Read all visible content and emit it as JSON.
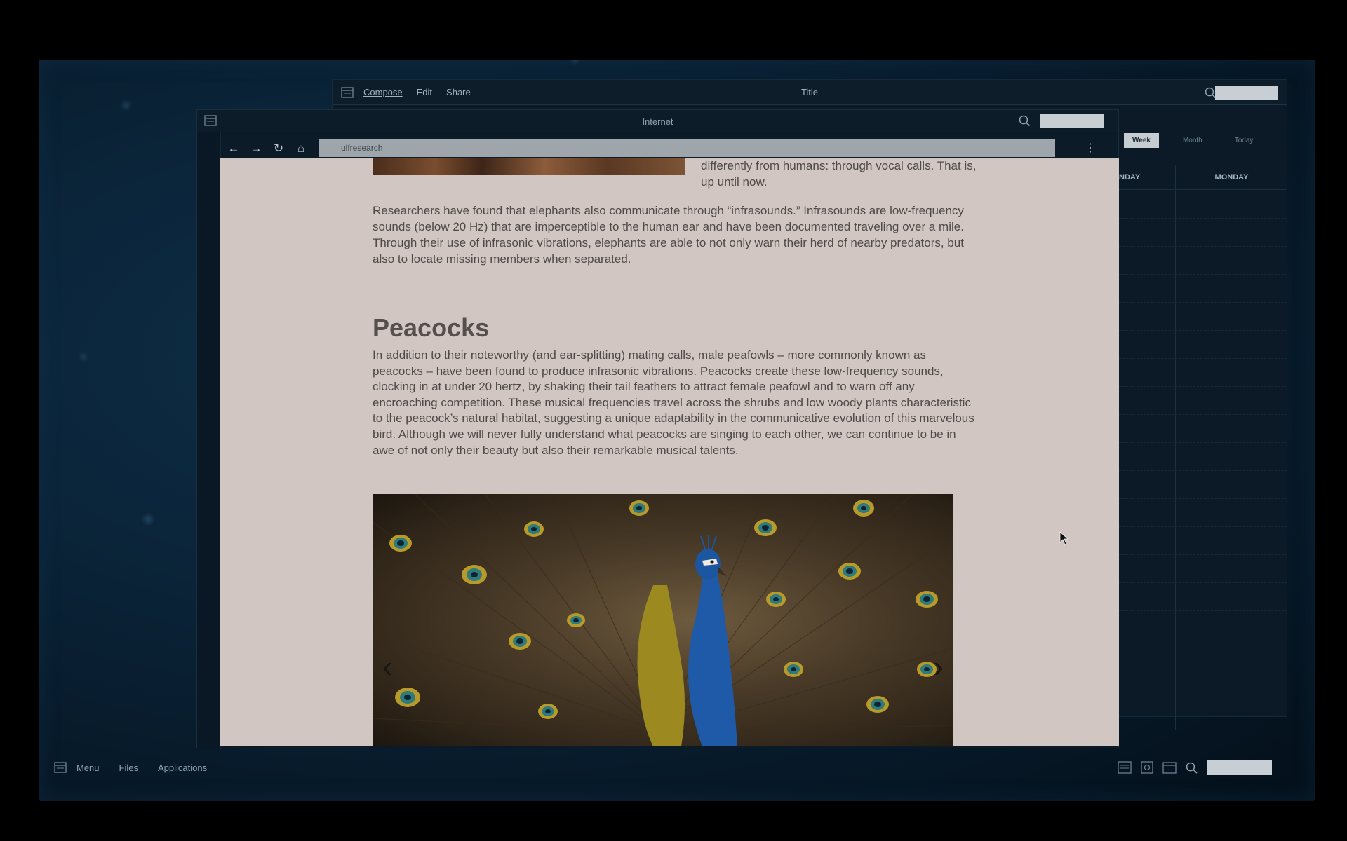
{
  "mail": {
    "menu": [
      "Compose",
      "Edit",
      "Share"
    ],
    "title": "Title"
  },
  "calendar": {
    "tabs": [
      "Week",
      "Month",
      "Today"
    ],
    "columns": [
      "NDAY",
      "MONDAY"
    ]
  },
  "browser": {
    "title": "Internet",
    "url": "ulfresearch"
  },
  "article": {
    "top_text": "differently from humans: through vocal calls. That is, up until now.",
    "paragraph1": "Researchers have found that elephants also communicate through “infrasounds.” Infrasounds are low-frequency sounds (below 20 Hz) that are imperceptible to the human ear and have been documented traveling over a mile. Through their use of infrasonic vibrations, elephants are able to not only warn their herd of nearby predators, but also to locate missing members when separated.",
    "heading": "Peacocks",
    "paragraph2": "In addition to their noteworthy (and ear-splitting) mating calls, male peafowls – more commonly known as peacocks – have been found to produce infrasonic vibrations. Peacocks create these low-frequency sounds, clocking in at under 20 hertz, by shaking their tail feathers to attract female peafowl and to warn off any encroaching competition. These musical frequencies travel across the shrubs and low woody plants characteristic to the peacock’s natural habitat, suggesting a unique adaptability in the communicative evolution of this marvelous bird. Although we will never fully understand what peacocks are singing to each other, we can continue to be in awe of not only their beauty but also their remarkable musical talents."
  },
  "taskbar": {
    "items": [
      "Menu",
      "Files",
      "Applications"
    ]
  }
}
